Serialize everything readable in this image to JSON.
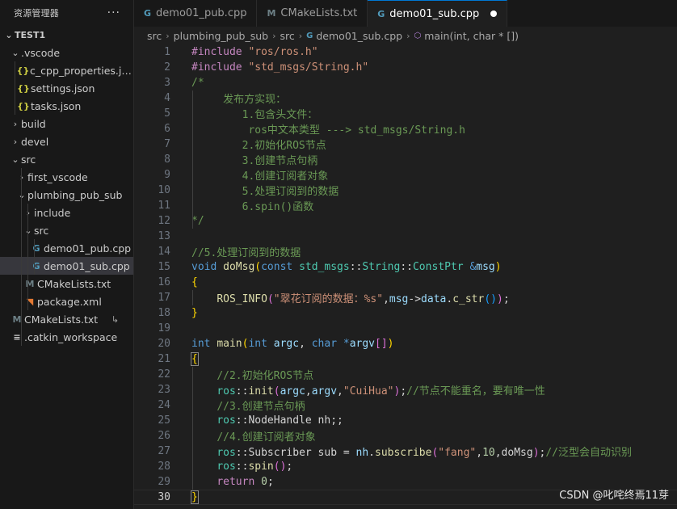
{
  "sidebar": {
    "title": "资源管理器",
    "more": "···",
    "items": [
      {
        "label": "TEST1",
        "chev": "⌄",
        "icon": "",
        "kind": "section"
      },
      {
        "label": ".vscode",
        "chev": "⌄",
        "icon": "",
        "kind": "folder"
      },
      {
        "label": "c_cpp_properties.json",
        "chev": "",
        "icon": "{}",
        "kind": "json"
      },
      {
        "label": "settings.json",
        "chev": "",
        "icon": "{}",
        "kind": "json"
      },
      {
        "label": "tasks.json",
        "chev": "",
        "icon": "{}",
        "kind": "json"
      },
      {
        "label": "build",
        "chev": "›",
        "icon": "",
        "kind": "folder"
      },
      {
        "label": "devel",
        "chev": "›",
        "icon": "",
        "kind": "folder"
      },
      {
        "label": "src",
        "chev": "⌄",
        "icon": "",
        "kind": "folder"
      },
      {
        "label": "first_vscode",
        "chev": "›",
        "icon": "",
        "kind": "folder"
      },
      {
        "label": "plumbing_pub_sub",
        "chev": "⌄",
        "icon": "",
        "kind": "folder"
      },
      {
        "label": "include",
        "chev": "›",
        "icon": "",
        "kind": "folder"
      },
      {
        "label": "src",
        "chev": "⌄",
        "icon": "",
        "kind": "folder"
      },
      {
        "label": "demo01_pub.cpp",
        "chev": "",
        "icon": "G",
        "kind": "cpp"
      },
      {
        "label": "demo01_sub.cpp",
        "chev": "",
        "icon": "G",
        "kind": "cpp"
      },
      {
        "label": "CMakeLists.txt",
        "chev": "",
        "icon": "M",
        "kind": "cmake"
      },
      {
        "label": "package.xml",
        "chev": "",
        "icon": "◥",
        "kind": "rss"
      },
      {
        "label": "CMakeLists.txt",
        "chev": "",
        "icon": "M",
        "kind": "cmake",
        "trail": "↳"
      },
      {
        "label": ".catkin_workspace",
        "chev": "",
        "icon": "≡",
        "kind": "ws"
      }
    ]
  },
  "tabs": [
    {
      "label": "demo01_pub.cpp",
      "icon": "G",
      "kind": "cpp",
      "active": false,
      "dirty": false
    },
    {
      "label": "CMakeLists.txt",
      "icon": "M",
      "kind": "cmake",
      "active": false,
      "dirty": false
    },
    {
      "label": "demo01_sub.cpp",
      "icon": "G",
      "kind": "cpp",
      "active": true,
      "dirty": true
    }
  ],
  "breadcrumb": {
    "parts": [
      "src",
      "plumbing_pub_sub",
      "src",
      "demo01_sub.cpp",
      "main(int, char * [])"
    ],
    "file_icon": "G",
    "symbol_icon": "⬡"
  },
  "editor": {
    "current_line": 30,
    "lines": [
      {
        "n": "1",
        "tokens": [
          [
            "p",
            "#include "
          ],
          [
            "s",
            "\"ros/ros.h\""
          ]
        ]
      },
      {
        "n": "2",
        "tokens": [
          [
            "p",
            "#include "
          ],
          [
            "s",
            "\"std_msgs/String.h\""
          ]
        ]
      },
      {
        "n": "3",
        "tokens": [
          [
            "c",
            "/*"
          ]
        ]
      },
      {
        "n": "4",
        "tokens": [
          [
            "c",
            "     发布方实现："
          ]
        ]
      },
      {
        "n": "5",
        "tokens": [
          [
            "c",
            "        1.包含头文件："
          ]
        ]
      },
      {
        "n": "6",
        "tokens": [
          [
            "c",
            "         ros中文本类型 ---> std_msgs/String.h"
          ]
        ]
      },
      {
        "n": "7",
        "tokens": [
          [
            "c",
            "        2.初始化ROS节点"
          ]
        ]
      },
      {
        "n": "8",
        "tokens": [
          [
            "c",
            "        3.创建节点句柄"
          ]
        ]
      },
      {
        "n": "9",
        "tokens": [
          [
            "c",
            "        4.创建订阅者对象"
          ]
        ]
      },
      {
        "n": "10",
        "tokens": [
          [
            "c",
            "        5.处理订阅到的数据"
          ]
        ]
      },
      {
        "n": "11",
        "tokens": [
          [
            "c",
            "        6.spin()函数"
          ]
        ]
      },
      {
        "n": "12",
        "tokens": [
          [
            "c",
            "*/"
          ]
        ]
      },
      {
        "n": "13",
        "tokens": []
      },
      {
        "n": "14",
        "tokens": [
          [
            "c",
            "//5.处理订阅到的数据"
          ]
        ]
      },
      {
        "n": "15",
        "tokens": [
          [
            "k",
            "void "
          ],
          [
            "f",
            "doMsg"
          ],
          [
            "b1",
            "("
          ],
          [
            "k",
            "const "
          ],
          [
            "t",
            "std_msgs"
          ],
          [
            "pl",
            "::"
          ],
          [
            "t",
            "String"
          ],
          [
            "pl",
            "::"
          ],
          [
            "t",
            "ConstPtr "
          ],
          [
            "k",
            "&"
          ],
          [
            "v",
            "msg"
          ],
          [
            "b1",
            ")"
          ]
        ]
      },
      {
        "n": "16",
        "tokens": [
          [
            "b1",
            "{"
          ]
        ]
      },
      {
        "n": "17",
        "tokens": [
          [
            "pl",
            "    "
          ],
          [
            "f",
            "ROS_INFO"
          ],
          [
            "b2",
            "("
          ],
          [
            "s",
            "\"翠花订阅的数据：%s\""
          ],
          [
            "pl",
            ","
          ],
          [
            "v",
            "msg"
          ],
          [
            "pl",
            "->"
          ],
          [
            "v",
            "data"
          ],
          [
            "pl",
            "."
          ],
          [
            "f",
            "c_str"
          ],
          [
            "b3",
            "()"
          ],
          [
            "b2",
            ")"
          ],
          [
            "pl",
            ";"
          ]
        ]
      },
      {
        "n": "18",
        "tokens": [
          [
            "b1",
            "}"
          ]
        ]
      },
      {
        "n": "19",
        "tokens": []
      },
      {
        "n": "20",
        "tokens": [
          [
            "k",
            "int "
          ],
          [
            "f",
            "main"
          ],
          [
            "b1",
            "("
          ],
          [
            "k",
            "int "
          ],
          [
            "v",
            "argc"
          ],
          [
            "pl",
            ", "
          ],
          [
            "k",
            "char "
          ],
          [
            "k",
            "*"
          ],
          [
            "v",
            "argv"
          ],
          [
            "b2",
            "[]"
          ],
          [
            "b1",
            ")"
          ]
        ]
      },
      {
        "n": "21",
        "tokens": [
          [
            "b1",
            "{"
          ]
        ]
      },
      {
        "n": "22",
        "tokens": [
          [
            "pl",
            "    "
          ],
          [
            "c",
            "//2.初始化ROS节点"
          ]
        ]
      },
      {
        "n": "23",
        "tokens": [
          [
            "pl",
            "    "
          ],
          [
            "t",
            "ros"
          ],
          [
            "pl",
            "::"
          ],
          [
            "f",
            "init"
          ],
          [
            "b2",
            "("
          ],
          [
            "v",
            "argc"
          ],
          [
            "pl",
            ","
          ],
          [
            "v",
            "argv"
          ],
          [
            "pl",
            ","
          ],
          [
            "s",
            "\"CuiHua\""
          ],
          [
            "b2",
            ")"
          ],
          [
            "pl",
            ";"
          ],
          [
            "c",
            "//节点不能重名，要有唯一性"
          ]
        ]
      },
      {
        "n": "24",
        "tokens": [
          [
            "pl",
            "    "
          ],
          [
            "c",
            "//3.创建节点句柄"
          ]
        ]
      },
      {
        "n": "25",
        "tokens": [
          [
            "pl",
            "    "
          ],
          [
            "t",
            "ros"
          ],
          [
            "pl",
            "::NodeHandle nh;;"
          ]
        ]
      },
      {
        "n": "26",
        "tokens": [
          [
            "pl",
            "    "
          ],
          [
            "c",
            "//4.创建订阅者对象"
          ]
        ]
      },
      {
        "n": "27",
        "tokens": [
          [
            "pl",
            "    "
          ],
          [
            "t",
            "ros"
          ],
          [
            "pl",
            "::Subscriber sub = "
          ],
          [
            "v",
            "nh"
          ],
          [
            "pl",
            "."
          ],
          [
            "f",
            "subscribe"
          ],
          [
            "b2",
            "("
          ],
          [
            "s",
            "\"fang\""
          ],
          [
            "pl",
            ","
          ],
          [
            "n",
            "10"
          ],
          [
            "pl",
            ",doMsg"
          ],
          [
            "b2",
            ")"
          ],
          [
            "pl",
            ";"
          ],
          [
            "c",
            "//泛型会自动识别"
          ]
        ]
      },
      {
        "n": "28",
        "tokens": [
          [
            "pl",
            "    "
          ],
          [
            "t",
            "ros"
          ],
          [
            "pl",
            "::"
          ],
          [
            "f",
            "spin"
          ],
          [
            "b2",
            "()"
          ],
          [
            "pl",
            ";"
          ]
        ]
      },
      {
        "n": "29",
        "tokens": [
          [
            "pl",
            "    "
          ],
          [
            "p",
            "return "
          ],
          [
            "n",
            "0"
          ],
          [
            "pl",
            ";"
          ]
        ]
      },
      {
        "n": "30",
        "tokens": [
          [
            "b1",
            "}"
          ]
        ]
      }
    ]
  },
  "watermark": "CSDN @叱咤终焉11芽"
}
